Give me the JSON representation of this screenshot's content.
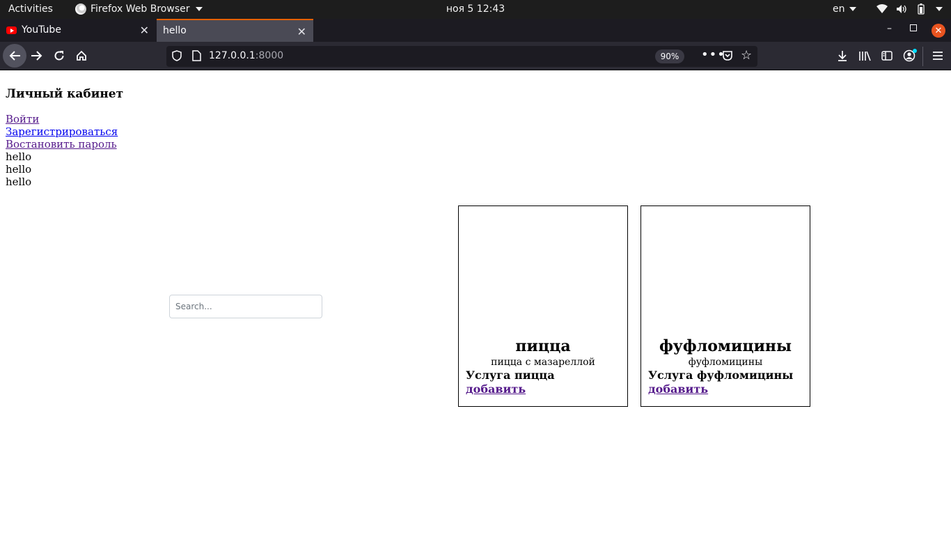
{
  "system_bar": {
    "activities": "Activities",
    "app_name": "Firefox Web Browser",
    "clock": "ноя 5  12:43",
    "language": "en"
  },
  "tabs": [
    {
      "title": "YouTube",
      "active": false
    },
    {
      "title": "hello",
      "active": true
    }
  ],
  "toolbar": {
    "url_host": "127.0.0.1",
    "url_port": ":8000",
    "zoom": "90%"
  },
  "page": {
    "heading": "Личный кабинет",
    "links": [
      {
        "label": "Войти",
        "visited": true
      },
      {
        "label": "Зарегистрироваться",
        "visited": false
      },
      {
        "label": "Востановить пароль",
        "visited": true
      }
    ],
    "hello_lines": [
      "hello",
      "hello",
      "hello"
    ],
    "search_placeholder": "Search...",
    "cards": [
      {
        "title": "пицца",
        "description": "пицца с мазареллой",
        "service": "Услуга пицца",
        "action": "добавить"
      },
      {
        "title": "фуфломицины",
        "description": "фуфломицины",
        "service": "Услуга фуфломицины",
        "action": "добавить"
      }
    ]
  },
  "colors": {
    "active_tab_accent": "#e66000",
    "link_unvisited": "#0000ee",
    "link_visited": "#551a8b",
    "close_button": "#e95420"
  }
}
